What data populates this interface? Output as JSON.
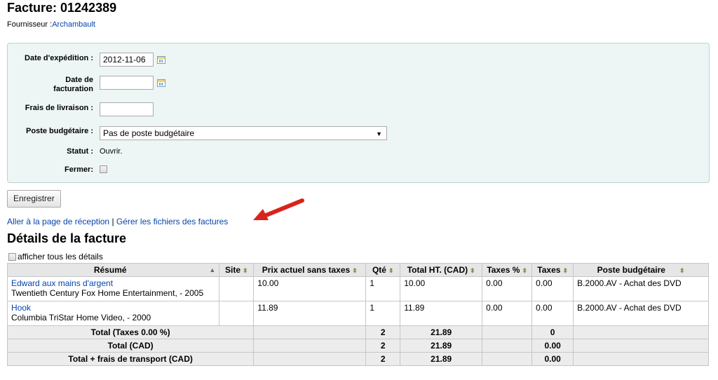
{
  "invoice": {
    "title": "Facture: 01242389",
    "supplier_prefix": "Fournisseur :",
    "supplier_name": "Archambault"
  },
  "form": {
    "shipping_date_label": "Date d'expédition :",
    "shipping_date_value": "2012-11-06",
    "billing_date_label_1": "Date de",
    "billing_date_label_2": "facturation",
    "billing_date_value": "",
    "shipping_cost_label": "Frais de livraison :",
    "shipping_cost_value": "",
    "budget_label": "Poste budgétaire :",
    "budget_selected": "Pas de poste budgétaire",
    "status_label": "Statut :",
    "status_value": "Ouvrir.",
    "close_label": "Fermer:"
  },
  "actions": {
    "save_label": "Enregistrer",
    "receive_link": "Aller à la page de réception",
    "separator": " | ",
    "files_link": "Gérer les fichiers des factures"
  },
  "details": {
    "title": "Détails de la facture",
    "show_all_label": "afficher tous les détails",
    "columns": [
      "Résumé",
      "Site",
      "Prix actuel sans taxes",
      "Qté",
      "Total HT. (CAD)",
      "Taxes %",
      "Taxes",
      "Poste budgétaire"
    ],
    "rows": [
      {
        "title": "Edward aux mains d'argent",
        "publisher": "Twentieth Century Fox Home Entertainment, - 2005",
        "site": "",
        "price": "10.00",
        "qty": "1",
        "total": "10.00",
        "tax_pct": "0.00",
        "tax": "0.00",
        "fund": "B.2000.AV - Achat des DVD"
      },
      {
        "title": "Hook",
        "publisher": "Columbia TriStar Home Video, - 2000",
        "site": "",
        "price": "11.89",
        "qty": "1",
        "total": "11.89",
        "tax_pct": "0.00",
        "tax": "0.00",
        "fund": "B.2000.AV - Achat des DVD"
      }
    ],
    "totals": [
      {
        "label": "Total (Taxes 0.00 %)",
        "qty": "2",
        "total": "21.89",
        "tax": "0"
      },
      {
        "label": "Total (CAD)",
        "qty": "2",
        "total": "21.89",
        "tax": "0.00"
      },
      {
        "label": "Total + frais de transport (CAD)",
        "qty": "2",
        "total": "21.89",
        "tax": "0.00"
      }
    ]
  },
  "colors": {
    "link": "#0645ad",
    "form_bg": "#eef5f5",
    "form_border": "#b7d4d4",
    "annotation_arrow": "#d8241c"
  }
}
